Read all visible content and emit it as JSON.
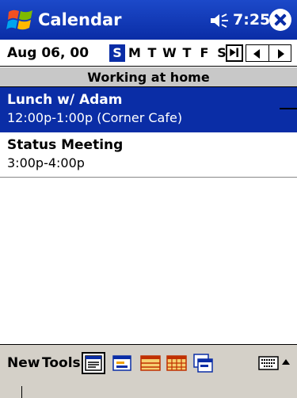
{
  "titlebar": {
    "app_title": "Calendar",
    "clock": "7:25",
    "start_icon": "windows-flag-icon",
    "speaker_icon": "speaker-icon",
    "close_icon": "close-icon"
  },
  "datebar": {
    "date": "Aug 06, 00",
    "weekdays": [
      "S",
      "M",
      "T",
      "W",
      "T",
      "F",
      "S"
    ],
    "selected_weekday_index": 0,
    "goto_today_icon": "goto-today-icon",
    "prev_icon": "prev-arrow-icon",
    "next_icon": "next-arrow-icon"
  },
  "all_day_banner": "Working at home",
  "appointments": [
    {
      "title": "Lunch w/ Adam",
      "time": "12:00p-1:00p (Corner Cafe)",
      "selected": true
    },
    {
      "title": "Status Meeting",
      "time": "3:00p-4:00p",
      "selected": false
    }
  ],
  "menubar": {
    "new_label": "New",
    "tools_label": "Tools",
    "views": [
      "agenda-view-icon",
      "day-view-icon",
      "week-view-icon",
      "month-view-icon",
      "year-view-icon"
    ],
    "active_view_index": 0,
    "keyboard_icon": "keyboard-icon"
  },
  "colors": {
    "titlebar": "#0a2da6",
    "selection": "#0a2da6",
    "banner": "#c8c8c8",
    "menubar": "#d4d0c8"
  }
}
